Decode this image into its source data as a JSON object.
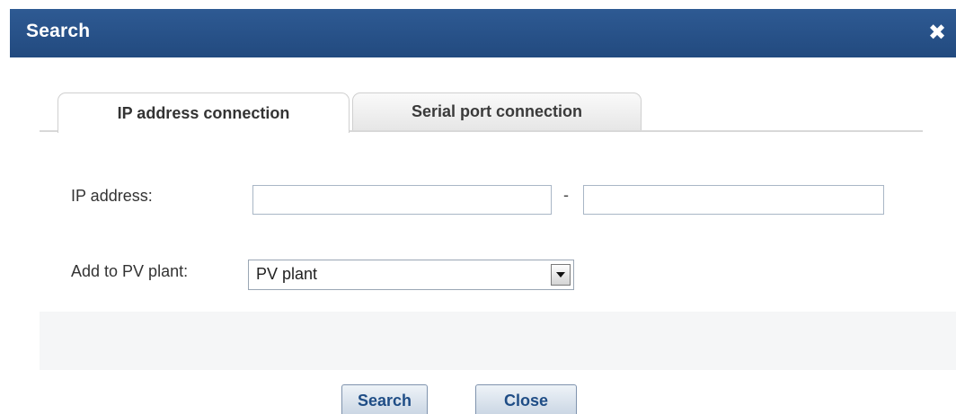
{
  "dialog": {
    "title": "Search",
    "close_icon": "close-icon"
  },
  "tabs": [
    {
      "label": "IP address connection",
      "active": true
    },
    {
      "label": "Serial port connection",
      "active": false
    }
  ],
  "form": {
    "ip_label": "IP address:",
    "ip_from_value": "",
    "ip_separator": "-",
    "ip_to_value": "",
    "plant_label": "Add to PV plant:",
    "plant_selected": "PV plant"
  },
  "buttons": {
    "search": "Search",
    "close": "Close"
  },
  "colors": {
    "titlebar": "#2e5a93",
    "button_text": "#1f4d86"
  }
}
